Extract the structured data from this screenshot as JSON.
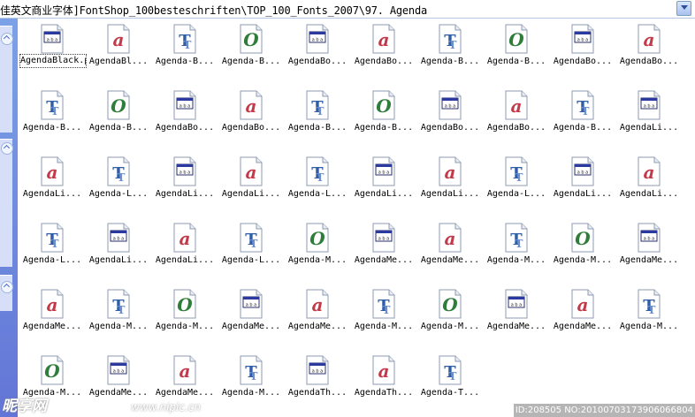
{
  "address_bar": {
    "path": "佳英文商业字体]FontShop_100besteschriften\\TOP_100_Fonts_2007\\97. Agenda"
  },
  "icon_colors": {
    "type1_red": "#c23a4a",
    "truetype_blue": "#2f5ea8",
    "opentype_green": "#2f7d3a"
  },
  "files": [
    {
      "label": "AgendaBlack.pfb",
      "icon": "pfb",
      "selected": true
    },
    {
      "label": "AgendaBl...",
      "icon": "type1"
    },
    {
      "label": "Agenda-B...",
      "icon": "truetype"
    },
    {
      "label": "Agenda-B...",
      "icon": "opentype"
    },
    {
      "label": "AgendaBo...",
      "icon": "pfb"
    },
    {
      "label": "AgendaBo...",
      "icon": "type1"
    },
    {
      "label": "Agenda-B...",
      "icon": "truetype"
    },
    {
      "label": "Agenda-B...",
      "icon": "opentype"
    },
    {
      "label": "AgendaBo...",
      "icon": "pfb"
    },
    {
      "label": "AgendaBo...",
      "icon": "type1"
    },
    {
      "label": "Agenda-B...",
      "icon": "truetype"
    },
    {
      "label": "Agenda-B...",
      "icon": "opentype"
    },
    {
      "label": "AgendaBo...",
      "icon": "pfb"
    },
    {
      "label": "AgendaBo...",
      "icon": "type1"
    },
    {
      "label": "Agenda-B...",
      "icon": "truetype"
    },
    {
      "label": "Agenda-B...",
      "icon": "opentype"
    },
    {
      "label": "AgendaBo...",
      "icon": "pfb"
    },
    {
      "label": "AgendaBo...",
      "icon": "type1"
    },
    {
      "label": "Agenda-B...",
      "icon": "truetype"
    },
    {
      "label": "AgendaLi...",
      "icon": "pfb"
    },
    {
      "label": "AgendaLi...",
      "icon": "type1"
    },
    {
      "label": "Agenda-L...",
      "icon": "truetype"
    },
    {
      "label": "AgendaLi...",
      "icon": "pfb"
    },
    {
      "label": "AgendaLi...",
      "icon": "type1"
    },
    {
      "label": "Agenda-L...",
      "icon": "truetype"
    },
    {
      "label": "AgendaLi...",
      "icon": "pfb"
    },
    {
      "label": "AgendaLi...",
      "icon": "type1"
    },
    {
      "label": "Agenda-L...",
      "icon": "truetype"
    },
    {
      "label": "AgendaLi...",
      "icon": "pfb"
    },
    {
      "label": "AgendaLi...",
      "icon": "type1"
    },
    {
      "label": "Agenda-L...",
      "icon": "truetype"
    },
    {
      "label": "AgendaLi...",
      "icon": "pfb"
    },
    {
      "label": "AgendaLi...",
      "icon": "type1"
    },
    {
      "label": "Agenda-L...",
      "icon": "truetype"
    },
    {
      "label": "Agenda-M...",
      "icon": "opentype"
    },
    {
      "label": "AgendaMe...",
      "icon": "pfb"
    },
    {
      "label": "AgendaMe...",
      "icon": "type1"
    },
    {
      "label": "Agenda-M...",
      "icon": "truetype"
    },
    {
      "label": "Agenda-M...",
      "icon": "opentype"
    },
    {
      "label": "AgendaMe...",
      "icon": "pfb"
    },
    {
      "label": "AgendaMe...",
      "icon": "type1"
    },
    {
      "label": "Agenda-M...",
      "icon": "truetype"
    },
    {
      "label": "Agenda-M...",
      "icon": "opentype"
    },
    {
      "label": "AgendaMe...",
      "icon": "pfb"
    },
    {
      "label": "AgendaMe...",
      "icon": "type1"
    },
    {
      "label": "Agenda-M...",
      "icon": "truetype"
    },
    {
      "label": "Agenda-M...",
      "icon": "opentype"
    },
    {
      "label": "AgendaMe...",
      "icon": "pfb"
    },
    {
      "label": "AgendaMe...",
      "icon": "type1"
    },
    {
      "label": "Agenda-M...",
      "icon": "truetype"
    },
    {
      "label": "Agenda-M...",
      "icon": "opentype"
    },
    {
      "label": "AgendaMe...",
      "icon": "pfb"
    },
    {
      "label": "AgendaMe...",
      "icon": "type1"
    },
    {
      "label": "Agenda-M...",
      "icon": "truetype"
    },
    {
      "label": "AgendaTh...",
      "icon": "pfb"
    },
    {
      "label": "AgendaTh...",
      "icon": "type1"
    },
    {
      "label": "Agenda-T...",
      "icon": "truetype"
    }
  ],
  "watermark": {
    "left": "昵享网",
    "mid": "www.nipic.cn",
    "right": "ID:208505 NO:20100703173906066804"
  }
}
